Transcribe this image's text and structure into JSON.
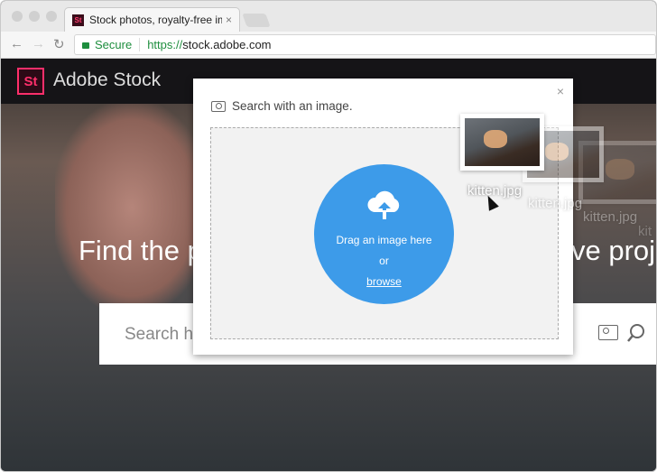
{
  "browser": {
    "tab_title": "Stock photos, royalty-free images",
    "tab_close": "×",
    "favicon": "St",
    "secure_label": "Secure",
    "url_scheme": "https://",
    "url_host": "stock.adobe.com"
  },
  "site": {
    "logo": "St",
    "brand": "Adobe Stock",
    "headline_left": "Find the p",
    "headline_right": "ve proje",
    "search_placeholder": "Search hig"
  },
  "modal": {
    "title": "Search with an image.",
    "close": "×",
    "drag_text": "Drag an image here",
    "or_text": "or",
    "browse": "browse"
  },
  "drag": {
    "filename": "kitten.jpg",
    "ghost1": "kitten.jpg",
    "ghost2": "kitten.jpg",
    "ghost3": "kit"
  },
  "colors": {
    "accent": "#3d9be9",
    "brand": "#ff2f6b",
    "secure": "#1e8e3e"
  }
}
